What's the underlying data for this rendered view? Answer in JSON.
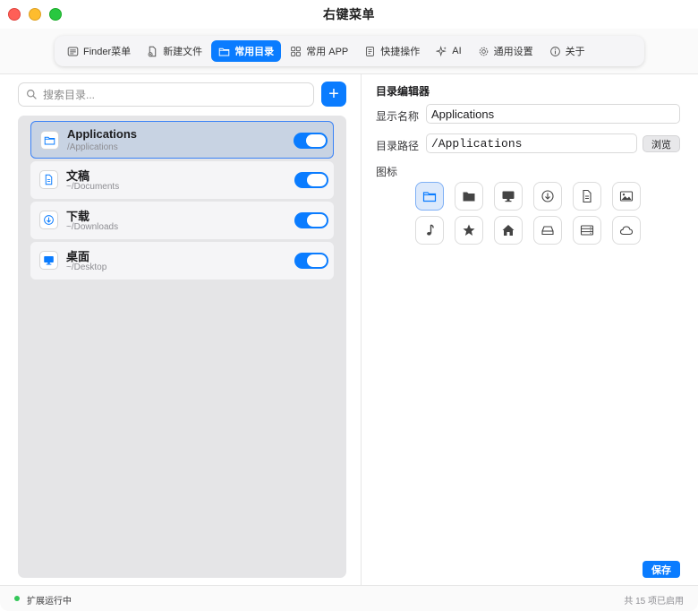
{
  "window": {
    "title": "右键菜单"
  },
  "tabs": [
    {
      "label": "Finder菜单",
      "icon": "menu-list-icon",
      "active": false
    },
    {
      "label": "新建文件",
      "icon": "new-file-icon",
      "active": false
    },
    {
      "label": "常用目录",
      "icon": "folder-icon",
      "active": true
    },
    {
      "label": "常用 APP",
      "icon": "grid-icon",
      "active": false
    },
    {
      "label": "快捷操作",
      "icon": "quick-action-icon",
      "active": false
    },
    {
      "label": "AI",
      "icon": "sparkle-icon",
      "active": false
    },
    {
      "label": "通用设置",
      "icon": "gear-icon",
      "active": false
    },
    {
      "label": "关于",
      "icon": "info-icon",
      "active": false
    }
  ],
  "sidebar": {
    "search_placeholder": "搜索目录...",
    "add_label": "+",
    "items": [
      {
        "name": "Applications",
        "path": "/Applications",
        "icon": "folder-icon",
        "enabled": true,
        "selected": true
      },
      {
        "name": "文稿",
        "path": "~/Documents",
        "icon": "document-icon",
        "enabled": true,
        "selected": false
      },
      {
        "name": "下载",
        "path": "~/Downloads",
        "icon": "download-icon",
        "enabled": true,
        "selected": false
      },
      {
        "name": "桌面",
        "path": "~/Desktop",
        "icon": "desktop-icon",
        "enabled": true,
        "selected": false
      }
    ]
  },
  "editor": {
    "title": "目录编辑器",
    "display_name_label": "显示名称",
    "display_name_value": "Applications",
    "path_label": "目录路径",
    "path_value": "/Applications",
    "browse_label": "浏览",
    "icon_label": "图标",
    "icons": [
      "folder-outline-icon",
      "folder-filled-icon",
      "desktop-icon",
      "download-icon",
      "document-icon",
      "photo-icon",
      "music-note-icon",
      "star-icon",
      "home-icon",
      "drive-icon",
      "server-icon",
      "cloud-icon"
    ],
    "selected_icon": "folder-outline-icon",
    "save_label": "保存"
  },
  "status": {
    "text": "扩展运行中",
    "count": "共 15 项已启用",
    "dot_color": "#34c759"
  },
  "colors": {
    "accent": "#0a7cff",
    "selected_row": "#c8d3e3"
  }
}
